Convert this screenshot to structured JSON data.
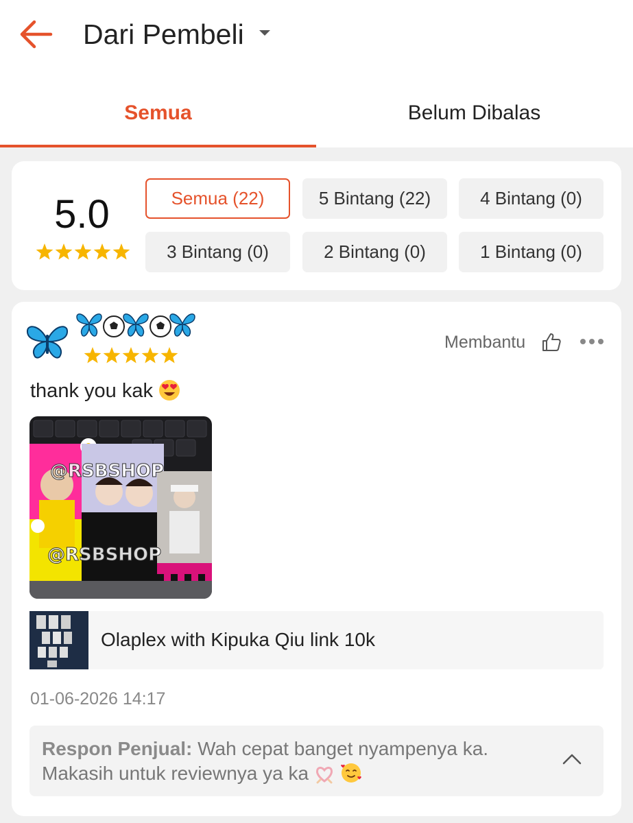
{
  "header": {
    "title": "Dari Pembeli",
    "back_icon": "arrow-left-icon",
    "dropdown_icon": "caret-down-icon"
  },
  "tabs": [
    {
      "label": "Semua",
      "active": true
    },
    {
      "label": "Belum Dibalas",
      "active": false
    }
  ],
  "summary": {
    "score": "5.0",
    "stars": 5,
    "filters": [
      {
        "label": "Semua (22)",
        "active": true
      },
      {
        "label": "5 Bintang (22)",
        "active": false
      },
      {
        "label": "4 Bintang (0)",
        "active": false
      },
      {
        "label": "3 Bintang (0)",
        "active": false
      },
      {
        "label": "2 Bintang (0)",
        "active": false
      },
      {
        "label": "1 Bintang (0)",
        "active": false
      }
    ]
  },
  "review": {
    "username_icons": "butterfly-soccer-emoji-name",
    "stars": 5,
    "helpful_label": "Membantu",
    "text": "thank you kak",
    "text_emoji": "heart-eyes-emoji",
    "photo_watermark": "@RSBSHOP",
    "product_name": "Olaplex with Kipuka Qiu link 10k",
    "date": "01-06-2026 14:17",
    "seller_response_label": "Respon Penjual:",
    "seller_response_text": "Wah cepat banget nyampenya ka. Makasih untuk reviewnya ya ka"
  },
  "colors": {
    "accent": "#e5522b",
    "star": "#f7b500",
    "background": "#f0f0f0"
  }
}
